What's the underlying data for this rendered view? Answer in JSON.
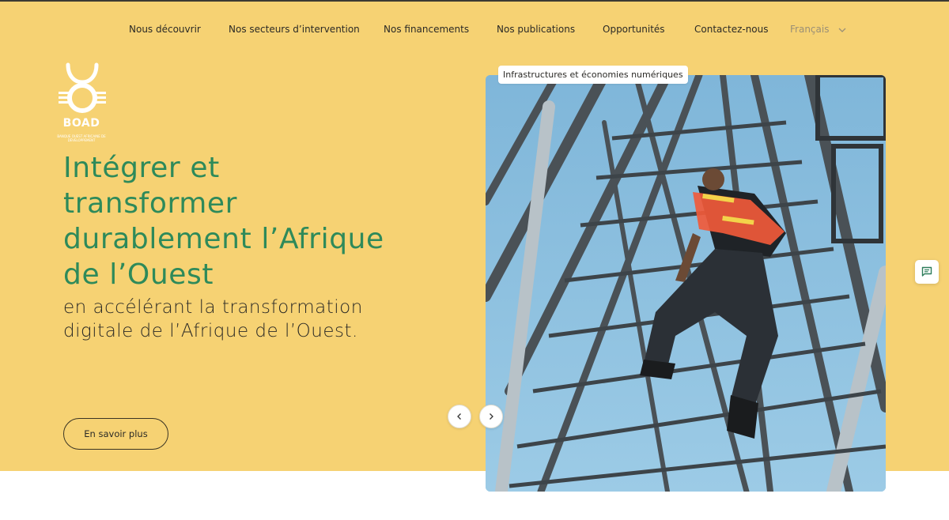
{
  "nav": {
    "items": [
      {
        "label": "Nous découvrir"
      },
      {
        "label": "Nos secteurs d’intervention"
      },
      {
        "label": "Nos financements"
      },
      {
        "label": "Nos publications"
      },
      {
        "label": "Opportunités"
      },
      {
        "label": "Contactez-nous"
      }
    ],
    "language": "Français"
  },
  "logo": {
    "name": "BOAD",
    "tagline": "BANQUE OUEST AFRICAINE DE DÉVELOPPEMENT"
  },
  "hero": {
    "title": "Intégrer et transformer durablement l’Afrique de l’Ouest",
    "subtitle": "en accélérant la transformation digitale de l’Afrique de l’Ouest.",
    "cta_label": "En savoir plus"
  },
  "slide": {
    "tag": "Infrastructures et économies numériques",
    "prev_icon": "chevron-left-icon",
    "next_icon": "chevron-right-icon"
  },
  "chat": {
    "icon": "chat-icon"
  },
  "colors": {
    "hero_bg": "#f6d273",
    "title_green": "#2e8a5a",
    "text_dark": "#2b2a26",
    "sky_blue": "#8fc0de"
  }
}
